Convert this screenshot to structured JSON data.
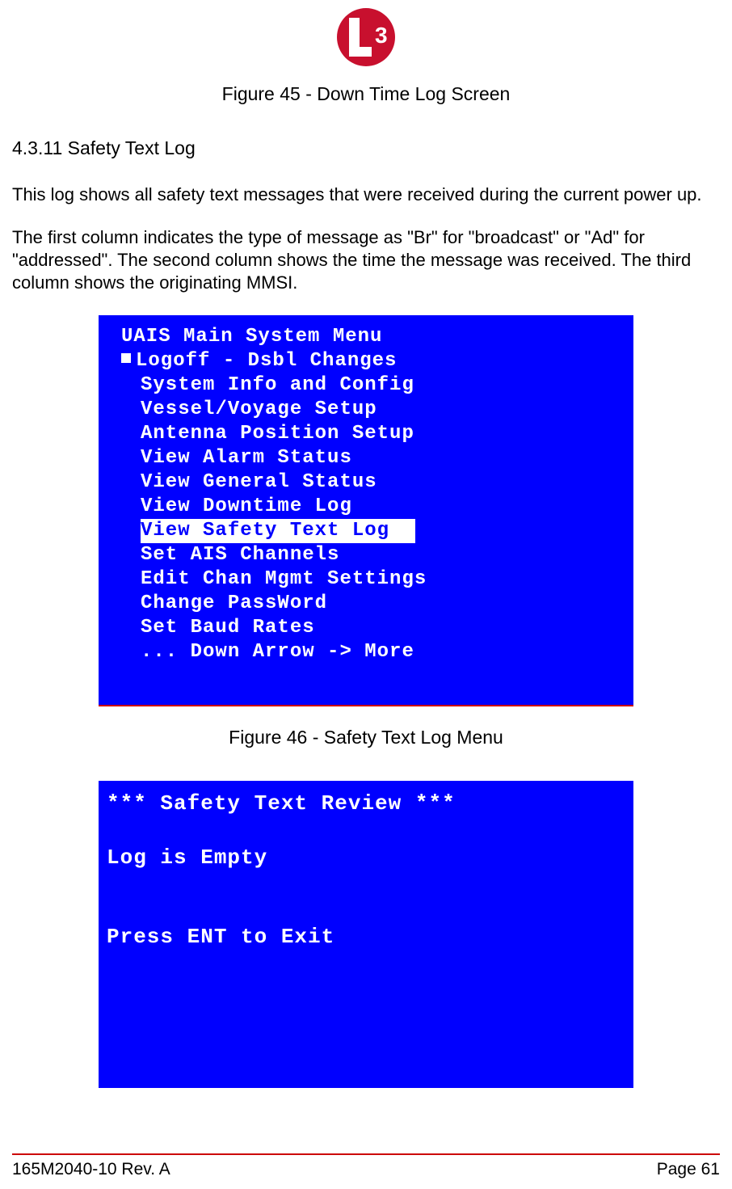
{
  "logo": {
    "brand": "L3"
  },
  "figure45_caption": "Figure 45 - Down Time Log Screen",
  "section_heading": "4.3.11 Safety Text Log",
  "para1": "This log shows all safety text messages that were received during the current power up.",
  "para2": "The first column indicates the type of message as \"Br\" for \"broadcast\" or \"Ad\" for \"addressed\".  The second column shows the time the message was received.  The third column shows the originating MMSI.",
  "screen1": {
    "title": "UAIS Main System Menu",
    "items": [
      "Logoff - Dsbl Changes",
      "System Info and Config",
      "Vessel/Voyage Setup",
      "Antenna Position Setup",
      "View Alarm Status",
      "View General Status",
      "View Downtime Log",
      "View Safety Text Log",
      "Set AIS Channels",
      "Edit Chan Mgmt Settings",
      "Change PassWord",
      "Set Baud Rates",
      "... Down Arrow -> More"
    ],
    "selected_index": 7,
    "cursor_index": 0
  },
  "figure46_caption": "Figure 46 - Safety Text Log Menu",
  "screen2": {
    "title": "*** Safety Text Review ***",
    "line2": "Log is Empty",
    "line3": "Press ENT to Exit"
  },
  "footer": {
    "left": "165M2040-10 Rev. A",
    "right": "Page 61"
  }
}
